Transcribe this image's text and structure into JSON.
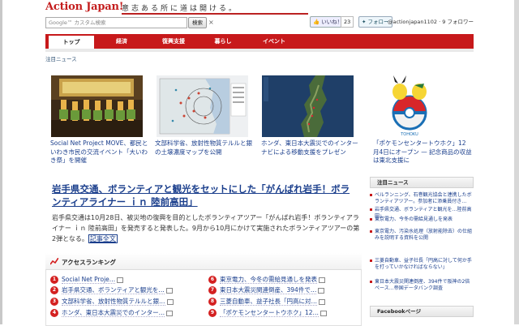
{
  "header": {
    "logo": "Action Japan!",
    "tagline": "意志ある所に道は開ける。",
    "search_placeholder": "Google™ カスタム検索",
    "search_button": "検索",
    "clear": "×",
    "like_label": "いいね！",
    "like_count": "23",
    "follow_label": "フォロー",
    "follow_text": "@actionjapan1102 · 9 フォロワー"
  },
  "nav": {
    "items": [
      {
        "label": "トップ",
        "active": true
      },
      {
        "label": "経済"
      },
      {
        "label": "復興支援"
      },
      {
        "label": "暮らし"
      },
      {
        "label": "イベント"
      }
    ]
  },
  "breadcrumb": "注目ニュース",
  "stories": [
    {
      "caption": "Social Net Project MOVE、都民といわき市民の交流イベント「大いわき祭」を開催"
    },
    {
      "caption": "文部科学省、放射性物質テルルと銀の土壌濃度マップを公開"
    },
    {
      "caption": "ホンダ、東日本大震災でのインターナビによる移動支援をプレゼン"
    },
    {
      "caption": "「ポケモンセンタートウホク」12月4日にオープン — 記念商品の収益は東北支援に"
    }
  ],
  "headline": {
    "title": "岩手県交通、ボランティアと観光をセットにした「がんばれ岩手！ボランティアライナー ｉｎ 陸前高田」",
    "body": "岩手県交通は10月28日、被災地の復興を目的としたボランティアツアー「がんばれ岩手！ボランティアライナー ｉｎ 陸前高田」を発売すると発表した。9月から10月にかけて実施されたボランティアツアーの第2弾となる。",
    "more": "記事全文"
  },
  "ranking": {
    "title": "アクセスランキング",
    "left": [
      {
        "num": "1",
        "text": "Social Net Proje…"
      },
      {
        "num": "2",
        "text": "岩手県交通、ボランティアと観光を…"
      },
      {
        "num": "3",
        "text": "文部科学省、放射性物質テルルと銀…"
      },
      {
        "num": "4",
        "text": "ホンダ、東日本大震災でのインター…"
      }
    ],
    "right": [
      {
        "num": "6",
        "text": "東京電力、今冬の需給見通しを発表"
      },
      {
        "num": "7",
        "text": "東日本大震災関連倒産、394件で…"
      },
      {
        "num": "8",
        "text": "三菱自動車、益子社長「円高に対…"
      },
      {
        "num": "9",
        "text": "「ポケモンセンタートウホク」12…"
      }
    ]
  },
  "sidebar": {
    "title": "注目ニュース",
    "items": [
      "ベルランニング、石巻観光協会と連携したボランティアツアー。参加者に添乗員付き…",
      "岩手県交通、ボランティアと観光を…陸前高田」",
      "東京電力、今冬の需給見通しを発表",
      "東京電力、汚染水処理（放射能除去）の仕組みを説明する資料を公開",
      "三菱自動車、益子社長「円高に対して何か手を打っていかなければならない」",
      "東日本大震災関連倒産、394件で阪神の2倍ペース…帝国データバンク調査"
    ],
    "facebook_title": "Facebookページ"
  },
  "colors": {
    "brand_red": "#c7191b",
    "link_blue": "#1a3e8c"
  }
}
